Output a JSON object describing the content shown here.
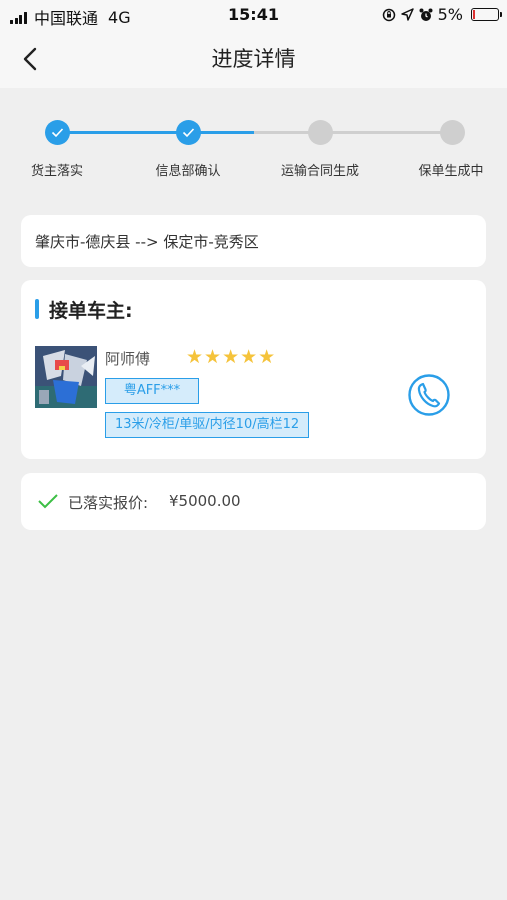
{
  "status_bar": {
    "carrier": "中国联通",
    "network": "4G",
    "time": "15:41",
    "battery": "5%"
  },
  "header": {
    "title": "进度详情"
  },
  "progress": {
    "steps": [
      {
        "label": "货主落实",
        "state": "done"
      },
      {
        "label": "信息部确认",
        "state": "done"
      },
      {
        "label": "运输合同生成",
        "state": "pending"
      },
      {
        "label": "保单生成中",
        "state": "pending"
      }
    ],
    "colors": {
      "done": "#2a9ee8",
      "pending": "#cfcfcf"
    }
  },
  "route": {
    "text": "肇庆市-德庆县 --> 保定市-竞秀区"
  },
  "driver": {
    "section_title": "接单车主:",
    "name": "阿师傅",
    "rating": 5,
    "stars": "★★★★★",
    "plate": "粤AFF***",
    "specs": "13米/冷柜/单驱/内径10/高栏12"
  },
  "quote": {
    "label": "已落实报价:",
    "value": "¥5000.00"
  }
}
